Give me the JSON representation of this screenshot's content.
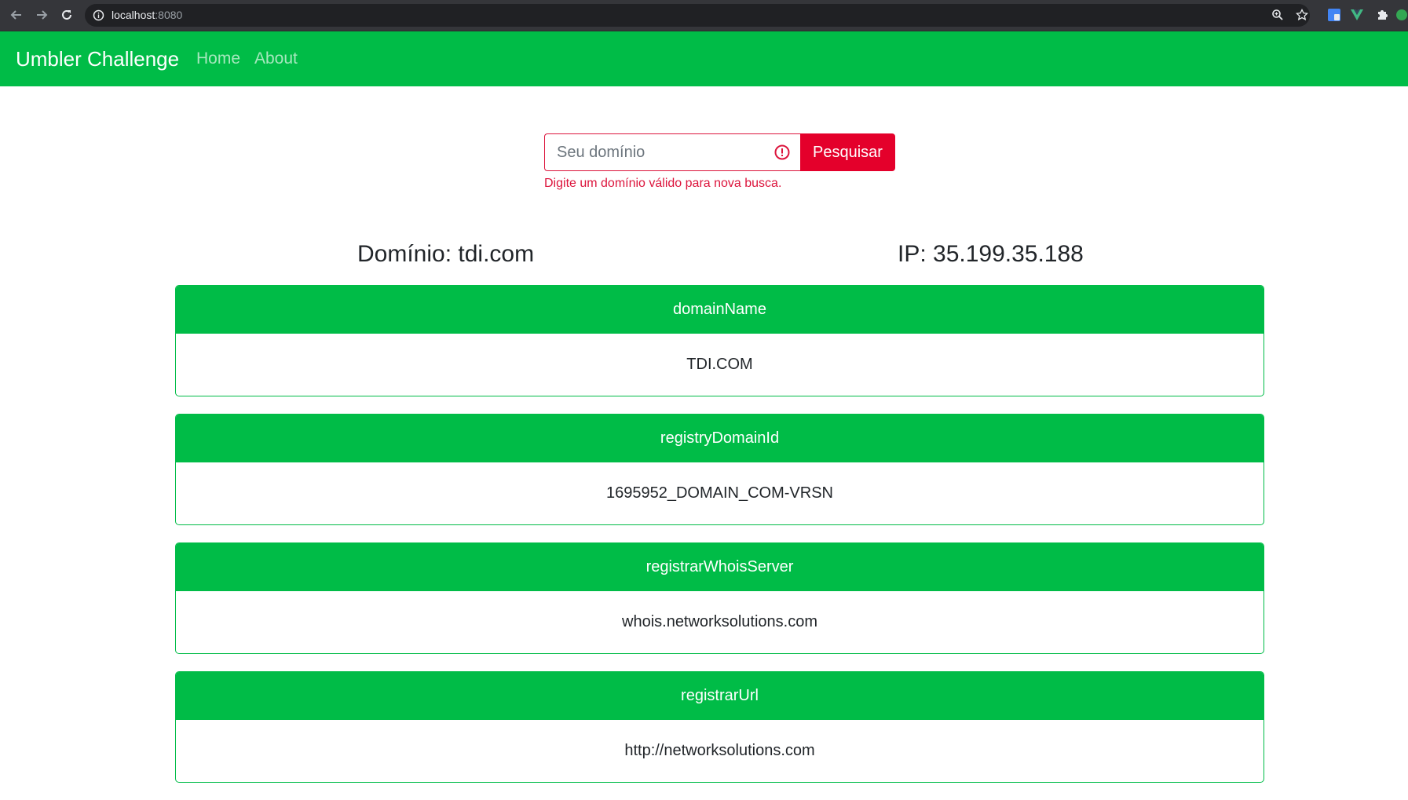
{
  "browser": {
    "url_host": "localhost",
    "url_port": ":8080"
  },
  "navbar": {
    "brand": "Umbler Challenge",
    "links": [
      "Home",
      "About"
    ]
  },
  "search": {
    "placeholder": "Seu domínio",
    "value": "",
    "button_label": "Pesquisar",
    "feedback": "Digite um domínio válido para nova busca."
  },
  "summary": {
    "domain": "Domínio: tdi.com",
    "ip": "IP: 35.199.35.188"
  },
  "cards": [
    {
      "header": "domainName",
      "value": "TDI.COM"
    },
    {
      "header": "registryDomainId",
      "value": "1695952_DOMAIN_COM-VRSN"
    },
    {
      "header": "registrarWhoisServer",
      "value": "whois.networksolutions.com"
    },
    {
      "header": "registrarUrl",
      "value": "http://networksolutions.com"
    }
  ],
  "colors": {
    "brand_green": "#00bc47",
    "danger_red": "#e4002b"
  }
}
